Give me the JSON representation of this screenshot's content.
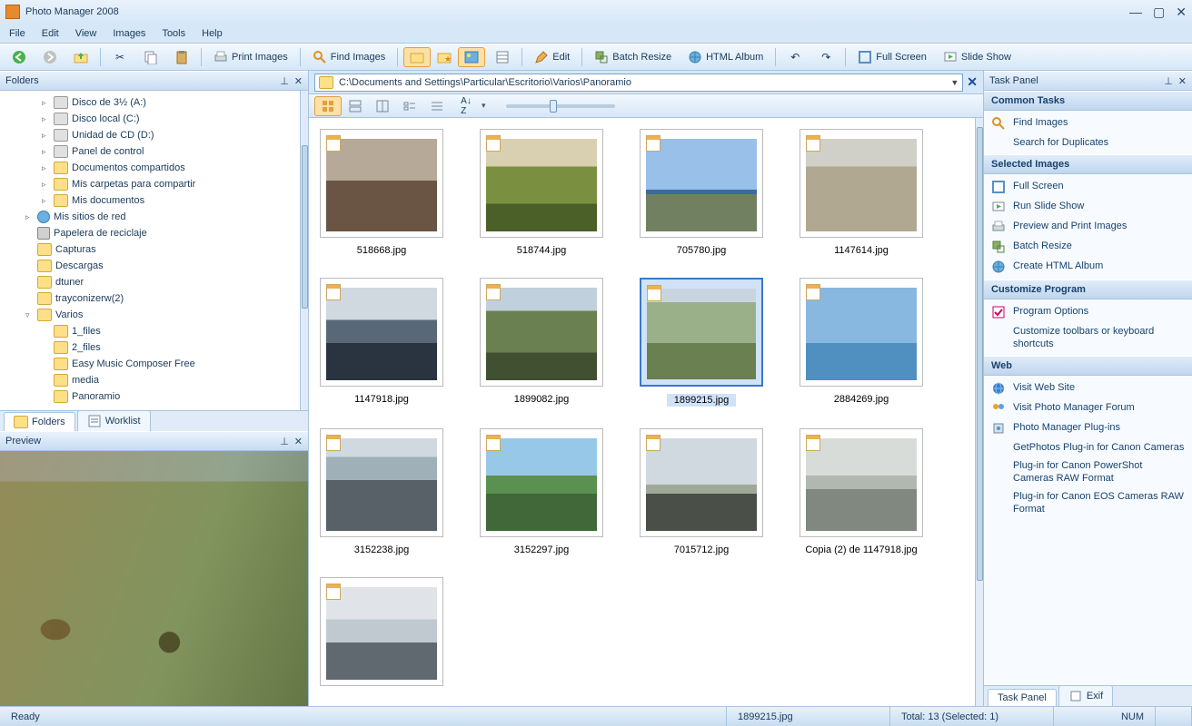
{
  "title": "Photo Manager 2008",
  "menu": [
    "File",
    "Edit",
    "View",
    "Images",
    "Tools",
    "Help"
  ],
  "toolbar": {
    "print": "Print Images",
    "find": "Find Images",
    "edit": "Edit",
    "batch": "Batch Resize",
    "html": "HTML Album",
    "full": "Full Screen",
    "slide": "Slide Show"
  },
  "folders_panel": {
    "title": "Folders"
  },
  "tree": [
    {
      "indent": 2,
      "exp": "▹",
      "icon": "drive",
      "label": "Disco de 3½ (A:)"
    },
    {
      "indent": 2,
      "exp": "▹",
      "icon": "drive",
      "label": "Disco local (C:)"
    },
    {
      "indent": 2,
      "exp": "▹",
      "icon": "drive",
      "label": "Unidad de CD (D:)"
    },
    {
      "indent": 2,
      "exp": "▹",
      "icon": "drive",
      "label": "Panel de control"
    },
    {
      "indent": 2,
      "exp": "▹",
      "icon": "folder",
      "label": "Documentos compartidos"
    },
    {
      "indent": 2,
      "exp": "▹",
      "icon": "folder",
      "label": "Mis carpetas para compartir"
    },
    {
      "indent": 2,
      "exp": "▹",
      "icon": "folder",
      "label": "Mis documentos"
    },
    {
      "indent": 1,
      "exp": "▹",
      "icon": "net",
      "label": "Mis sitios de red"
    },
    {
      "indent": 1,
      "exp": "",
      "icon": "bin",
      "label": "Papelera de reciclaje"
    },
    {
      "indent": 1,
      "exp": "",
      "icon": "folder",
      "label": "Capturas"
    },
    {
      "indent": 1,
      "exp": "",
      "icon": "folder",
      "label": "Descargas"
    },
    {
      "indent": 1,
      "exp": "",
      "icon": "folder",
      "label": "dtuner"
    },
    {
      "indent": 1,
      "exp": "",
      "icon": "folder",
      "label": "trayconizerw(2)"
    },
    {
      "indent": 1,
      "exp": "▿",
      "icon": "folder",
      "label": "Varios"
    },
    {
      "indent": 2,
      "exp": "",
      "icon": "folder",
      "label": "1_files"
    },
    {
      "indent": 2,
      "exp": "",
      "icon": "folder",
      "label": "2_files"
    },
    {
      "indent": 2,
      "exp": "",
      "icon": "folder",
      "label": "Easy Music Composer Free"
    },
    {
      "indent": 2,
      "exp": "",
      "icon": "folder",
      "label": "media"
    },
    {
      "indent": 2,
      "exp": "",
      "icon": "folder",
      "label": "Panoramio"
    }
  ],
  "folder_tabs": {
    "folders": "Folders",
    "worklist": "Worklist"
  },
  "preview_panel": {
    "title": "Preview"
  },
  "address": "C:\\Documents and Settings\\Particular\\Escritorio\\Varios\\Panoramio",
  "thumbs": [
    {
      "name": "518668.jpg",
      "art": "art1"
    },
    {
      "name": "518744.jpg",
      "art": "art2"
    },
    {
      "name": "705780.jpg",
      "art": "art3"
    },
    {
      "name": "1147614.jpg",
      "art": "art4"
    },
    {
      "name": "1147918.jpg",
      "art": "art5"
    },
    {
      "name": "1899082.jpg",
      "art": "art6"
    },
    {
      "name": "1899215.jpg",
      "art": "art7",
      "selected": true
    },
    {
      "name": "2884269.jpg",
      "art": "art8"
    },
    {
      "name": "3152238.jpg",
      "art": "art9"
    },
    {
      "name": "3152297.jpg",
      "art": "art10"
    },
    {
      "name": "7015712.jpg",
      "art": "art11"
    },
    {
      "name": "Copia (2) de 1147918.jpg",
      "art": "art12"
    },
    {
      "name": "",
      "art": "art13",
      "partial": true
    }
  ],
  "task_panel": {
    "title": "Task Panel",
    "sections": {
      "common": {
        "title": "Common Tasks",
        "items": [
          "Find Images",
          "Search for Duplicates"
        ]
      },
      "selected": {
        "title": "Selected Images",
        "items": [
          "Full Screen",
          "Run Slide Show",
          "Preview and Print Images",
          "Batch Resize",
          "Create HTML Album"
        ]
      },
      "customize": {
        "title": "Customize Program",
        "items": [
          "Program Options",
          "Customize toolbars or keyboard shortcuts"
        ]
      },
      "web": {
        "title": "Web",
        "items": [
          "Visit Web Site",
          "Visit Photo Manager Forum",
          "Photo Manager Plug-ins",
          "GetPhotos Plug-in for Canon Cameras",
          "Plug-in for Canon PowerShot Cameras RAW Format",
          "Plug-in for Canon EOS Cameras RAW Format"
        ]
      }
    },
    "tabs": {
      "task": "Task Panel",
      "exif": "Exif"
    }
  },
  "status": {
    "ready": "Ready",
    "file": "1899215.jpg",
    "total": "Total: 13 (Selected: 1)",
    "num": "NUM"
  }
}
